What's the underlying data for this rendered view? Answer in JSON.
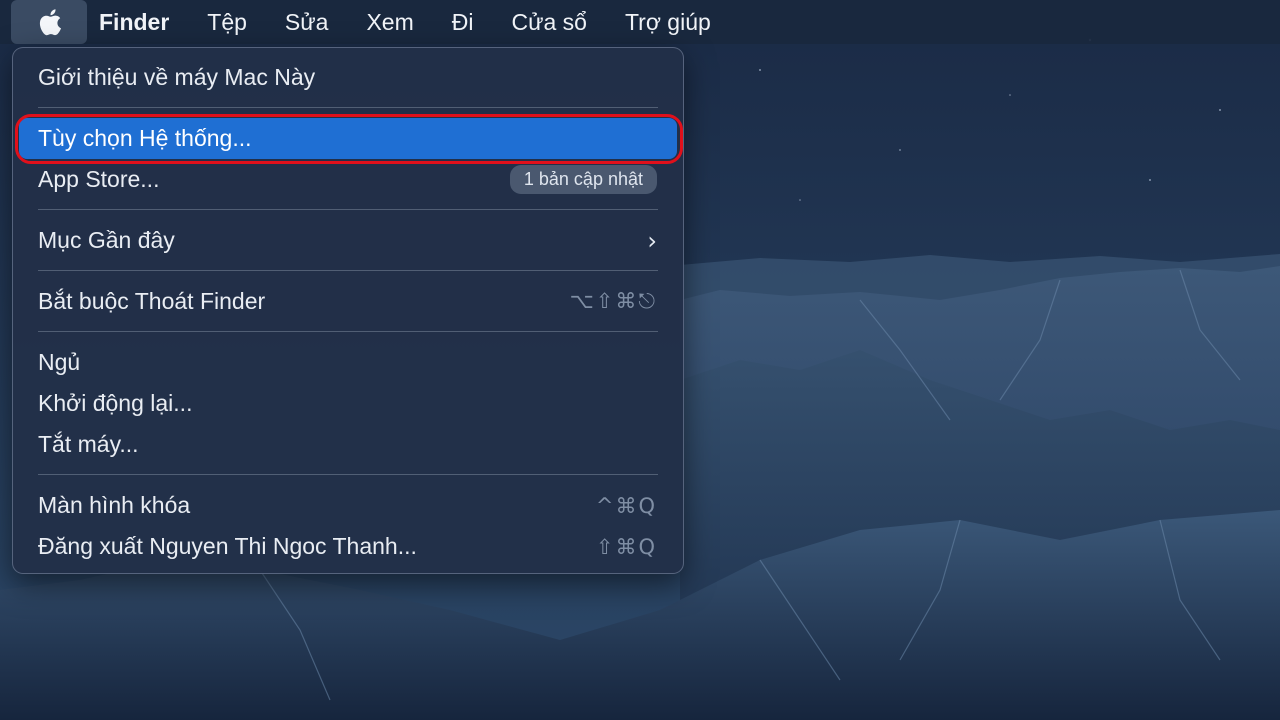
{
  "menubar": {
    "apple_icon": "apple-logo",
    "items": [
      "Finder",
      "Tệp",
      "Sửa",
      "Xem",
      "Đi",
      "Cửa sổ",
      "Trợ giúp"
    ]
  },
  "apple_menu": {
    "about": "Giới thiệu về máy Mac Này",
    "system_prefs": "Tùy chọn Hệ thống...",
    "app_store": "App Store...",
    "app_store_badge": "1 bản cập nhật",
    "recent_items": "Mục Gần đây",
    "recent_items_arrow": "›",
    "force_quit": "Bắt buộc Thoát Finder",
    "force_quit_shortcut": "⌥⇧⌘⎋",
    "sleep": "Ngủ",
    "restart": "Khởi động lại...",
    "shutdown": "Tắt máy...",
    "lock_screen": "Màn hình khóa",
    "lock_screen_shortcut": "^⌘Q",
    "logout": "Đăng xuất Nguyen Thi Ngoc Thanh...",
    "logout_shortcut": "⇧⌘Q"
  },
  "colors": {
    "selection": "#1f6fd3",
    "highlight_ring": "#e0101b"
  }
}
